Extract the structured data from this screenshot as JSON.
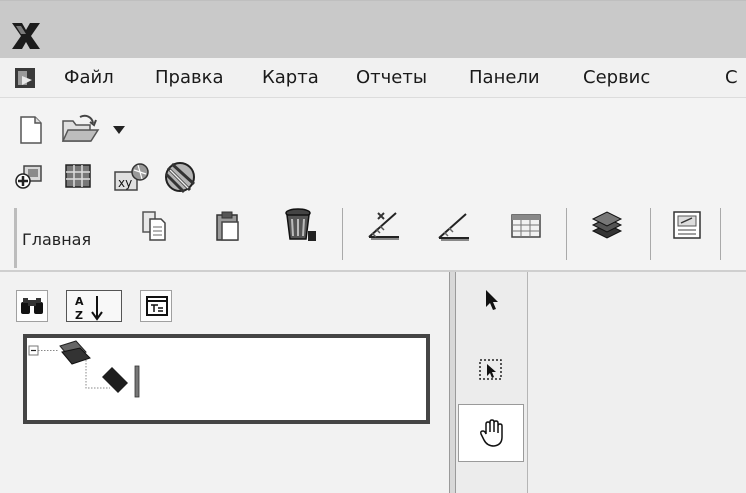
{
  "menubar": {
    "items": [
      "Файл",
      "Правка",
      "Карта",
      "Отчеты",
      "Панели",
      "Сервис",
      "С"
    ]
  },
  "toolbar": {
    "row1": [
      "new-document-icon",
      "open-folder-icon",
      "dropdown-arrow-icon"
    ],
    "row2": [
      "add-layer-icon",
      "grid-table-icon",
      "xy-data-icon",
      "globe-tool-icon"
    ]
  },
  "ribbon": {
    "label": "Главная",
    "icons": [
      "copy-icon",
      "paste-icon",
      "delete-icon",
      "measure-angle-icon",
      "measure-edit-icon",
      "attribute-table-icon",
      "layers-icon",
      "map-properties-icon"
    ]
  },
  "panel": {
    "buttons": [
      "find-binoculars-icon",
      "sort-az-icon",
      "properties-icon"
    ],
    "tree_expander": "−"
  },
  "tools": [
    "select-arrow-icon",
    "select-box-icon",
    "pan-hand-icon"
  ]
}
